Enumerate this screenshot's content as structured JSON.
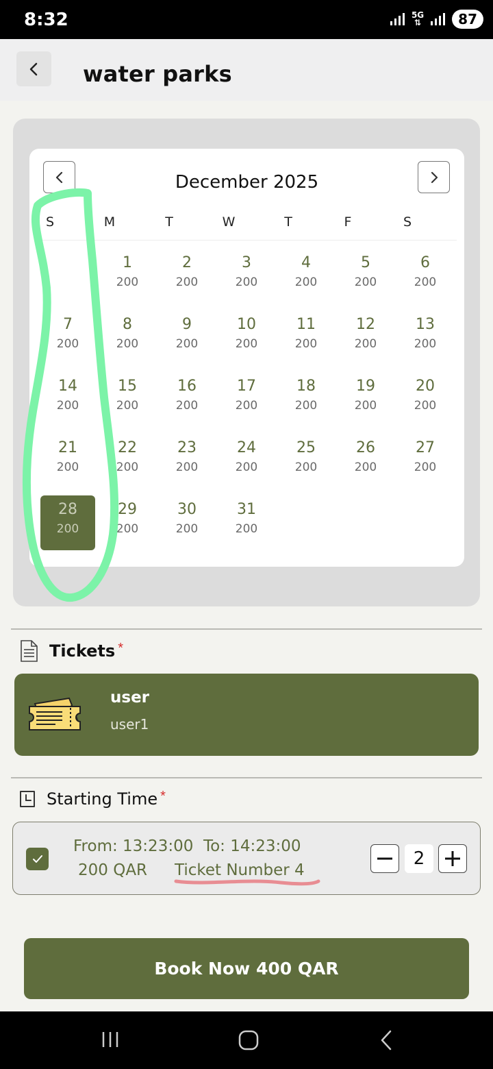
{
  "status_bar": {
    "time": "8:32",
    "network": "5G",
    "battery": "87"
  },
  "header": {
    "title": "water parks",
    "back_icon": "chevron-left-icon"
  },
  "calendar": {
    "month_label": "December 2025",
    "prev_icon": "chevron-left-icon",
    "next_icon": "chevron-right-icon",
    "weekdays": [
      "S",
      "M",
      "T",
      "W",
      "T",
      "F",
      "S"
    ],
    "days": [
      {
        "day": "1",
        "price": "200"
      },
      {
        "day": "2",
        "price": "200"
      },
      {
        "day": "3",
        "price": "200"
      },
      {
        "day": "4",
        "price": "200"
      },
      {
        "day": "5",
        "price": "200"
      },
      {
        "day": "6",
        "price": "200"
      },
      {
        "day": "7",
        "price": "200"
      },
      {
        "day": "8",
        "price": "200"
      },
      {
        "day": "9",
        "price": "200"
      },
      {
        "day": "10",
        "price": "200"
      },
      {
        "day": "11",
        "price": "200"
      },
      {
        "day": "12",
        "price": "200"
      },
      {
        "day": "13",
        "price": "200"
      },
      {
        "day": "14",
        "price": "200"
      },
      {
        "day": "15",
        "price": "200"
      },
      {
        "day": "16",
        "price": "200"
      },
      {
        "day": "17",
        "price": "200"
      },
      {
        "day": "18",
        "price": "200"
      },
      {
        "day": "19",
        "price": "200"
      },
      {
        "day": "20",
        "price": "200"
      },
      {
        "day": "21",
        "price": "200"
      },
      {
        "day": "22",
        "price": "200"
      },
      {
        "day": "23",
        "price": "200"
      },
      {
        "day": "24",
        "price": "200"
      },
      {
        "day": "25",
        "price": "200"
      },
      {
        "day": "26",
        "price": "200"
      },
      {
        "day": "27",
        "price": "200"
      },
      {
        "day": "28",
        "price": "200"
      },
      {
        "day": "29",
        "price": "200"
      },
      {
        "day": "30",
        "price": "200"
      },
      {
        "day": "31",
        "price": "200"
      }
    ],
    "first_weekday_index": 1,
    "selected_day": "28"
  },
  "tickets": {
    "section_title": "Tickets",
    "required_mark": "*",
    "icon": "ticket-icon",
    "item": {
      "name": "user",
      "subtitle": "user1"
    }
  },
  "starting_time": {
    "section_title": "Starting Time",
    "required_mark": "*",
    "icon": "clock-icon",
    "slot": {
      "checked": true,
      "time_range": "From: 13:23:00  To: 14:23:00",
      "price": "200 QAR",
      "ticket_number": "Ticket Number 4",
      "quantity": "2"
    }
  },
  "book_button": {
    "label": "Book Now 400 QAR"
  },
  "colors": {
    "accent": "#5f6d3d",
    "annotation_green": "#7cf3a8",
    "annotation_pink": "#e88d93",
    "required": "#d62f2f"
  }
}
